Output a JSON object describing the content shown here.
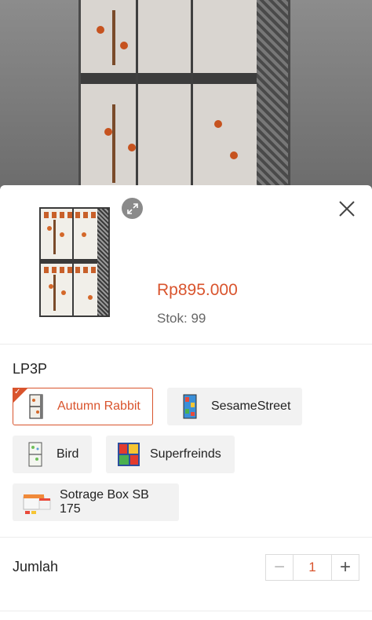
{
  "product": {
    "price": "Rp895.000",
    "stock": "Stok: 99"
  },
  "variants": {
    "group_label": "LP3P",
    "options": [
      {
        "label": "Autumn Rabbit",
        "selected": true
      },
      {
        "label": "SesameStreet",
        "selected": false
      },
      {
        "label": "Bird",
        "selected": false
      },
      {
        "label": "Superfreinds",
        "selected": false
      },
      {
        "label": "Sotrage Box SB 175",
        "selected": false
      }
    ],
    "selected_check_icon": "✓"
  },
  "quantity": {
    "label": "Jumlah",
    "minus": "−",
    "value": "1",
    "plus": "+"
  },
  "colors": {
    "accent": "#d9542d"
  },
  "icons": {
    "expand": "expand-icon",
    "close": "close-icon"
  }
}
